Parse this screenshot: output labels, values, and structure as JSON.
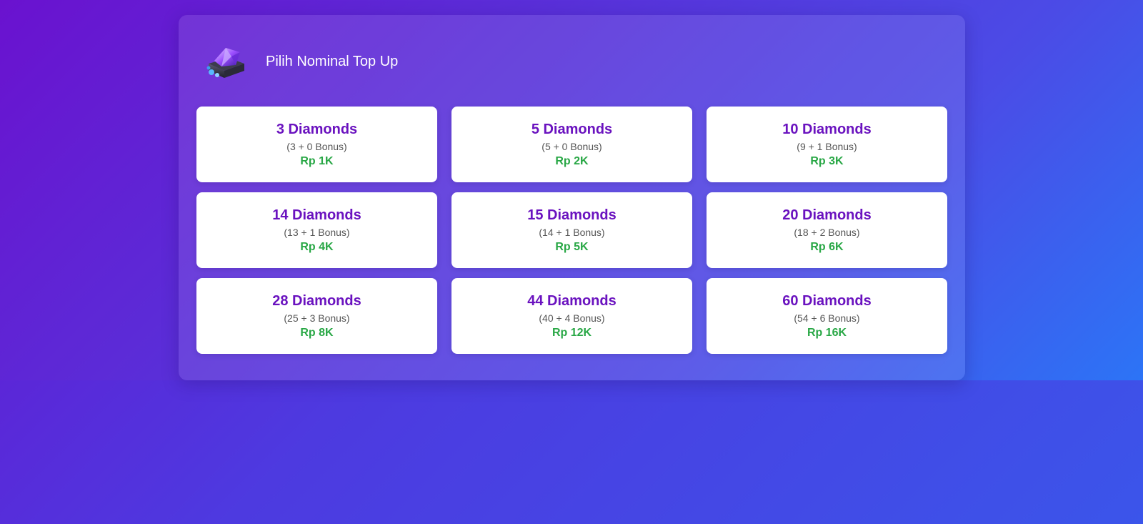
{
  "header": {
    "title": "Pilih Nominal Top Up",
    "icon": "diamond-chest-icon"
  },
  "colors": {
    "title": "#6a12bf",
    "price": "#28a745",
    "bonus": "#555555"
  },
  "options": [
    {
      "title": "3 Diamonds",
      "bonus": "(3 + 0 Bonus)",
      "price": "Rp 1K"
    },
    {
      "title": "5 Diamonds",
      "bonus": "(5 + 0 Bonus)",
      "price": "Rp 2K"
    },
    {
      "title": "10 Diamonds",
      "bonus": "(9 + 1 Bonus)",
      "price": "Rp 3K"
    },
    {
      "title": "14 Diamonds",
      "bonus": "(13 + 1 Bonus)",
      "price": "Rp 4K"
    },
    {
      "title": "15 Diamonds",
      "bonus": "(14 + 1 Bonus)",
      "price": "Rp 5K"
    },
    {
      "title": "20 Diamonds",
      "bonus": "(18 + 2 Bonus)",
      "price": "Rp 6K"
    },
    {
      "title": "28 Diamonds",
      "bonus": "(25 + 3 Bonus)",
      "price": "Rp 8K"
    },
    {
      "title": "44 Diamonds",
      "bonus": "(40 + 4 Bonus)",
      "price": "Rp 12K"
    },
    {
      "title": "60 Diamonds",
      "bonus": "(54 + 6 Bonus)",
      "price": "Rp 16K"
    }
  ]
}
